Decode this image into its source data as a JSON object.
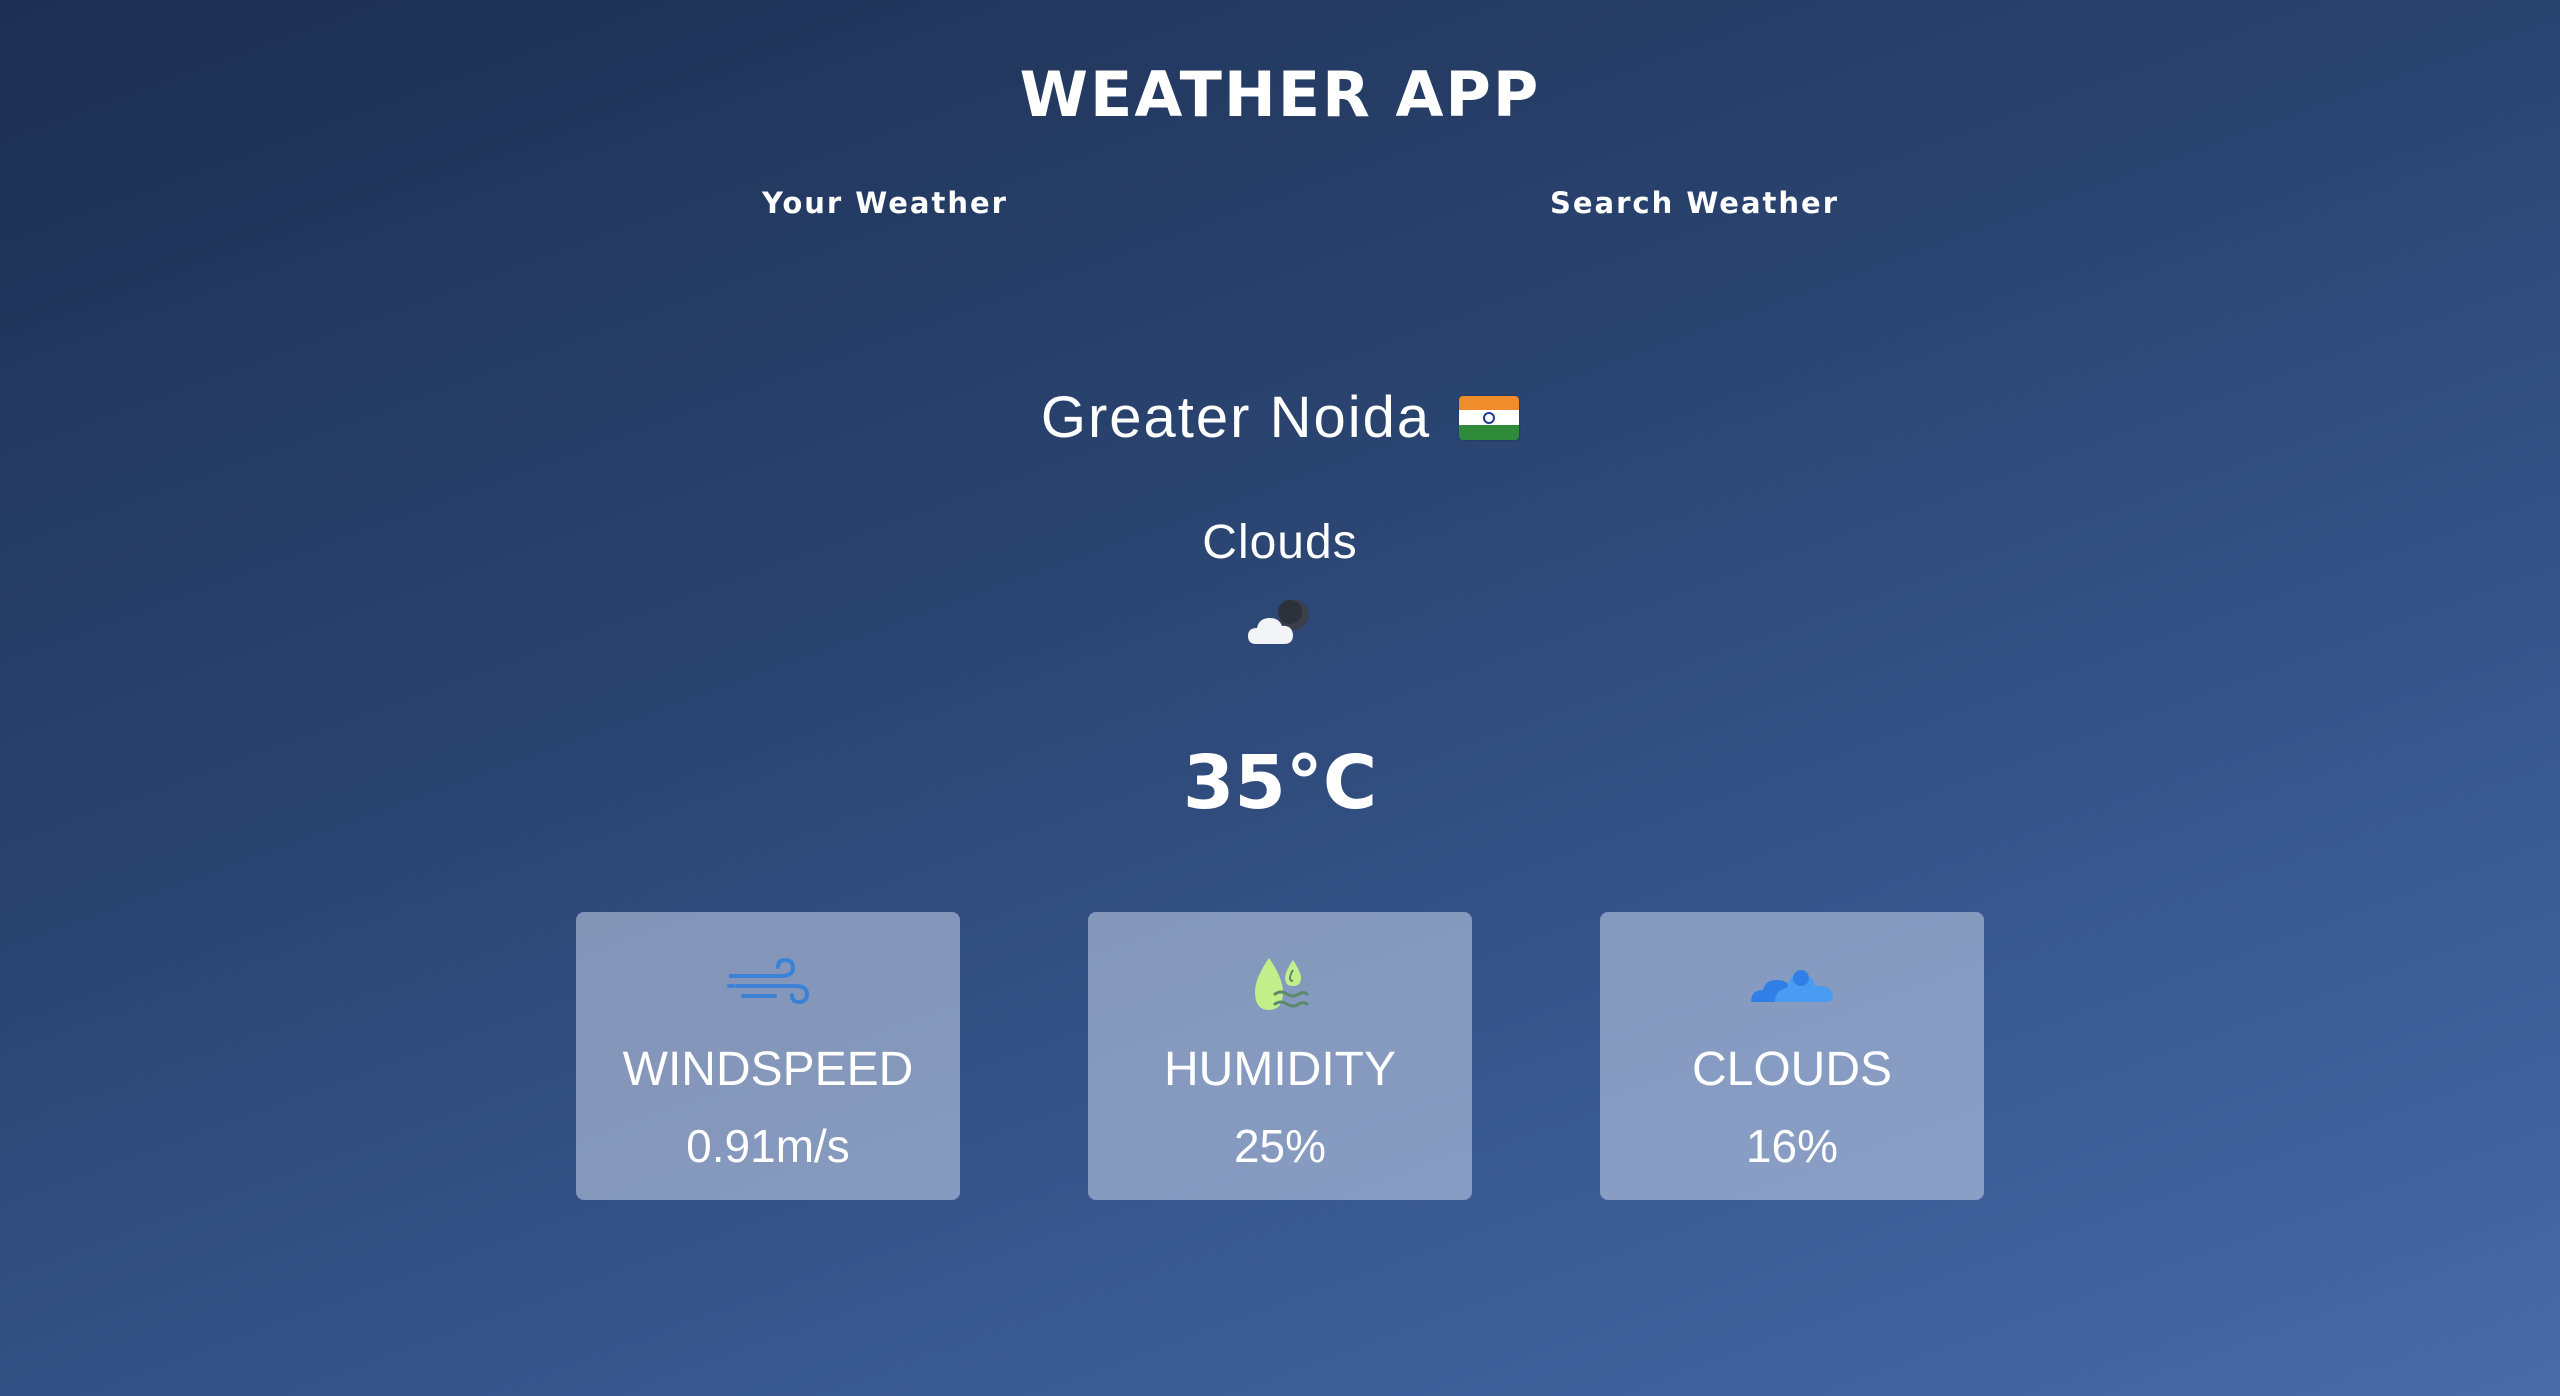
{
  "app": {
    "title": "WEATHER APP"
  },
  "tabs": [
    {
      "label": "Your Weather"
    },
    {
      "label": "Search Weather"
    }
  ],
  "location": {
    "city": "Greater Noida",
    "flag_icon": "india-flag-icon"
  },
  "weather": {
    "condition": "Clouds",
    "condition_icon": "cloud-night-icon",
    "temperature": "35°C"
  },
  "stats": [
    {
      "label": "WINDSPEED",
      "value": "0.91m/s",
      "icon": "wind-icon",
      "icon_color": "#3b82d6"
    },
    {
      "label": "HUMIDITY",
      "value": "25%",
      "icon": "humidity-icon",
      "icon_color": "#c3ef8a"
    },
    {
      "label": "CLOUDS",
      "value": "16%",
      "icon": "clouds-icon",
      "icon_color": "#3f8fef"
    }
  ],
  "colors": {
    "background_top": "#1d2f52",
    "background_bottom": "#4a6aa8",
    "card_background": "rgba(200,212,235,0.55)"
  }
}
